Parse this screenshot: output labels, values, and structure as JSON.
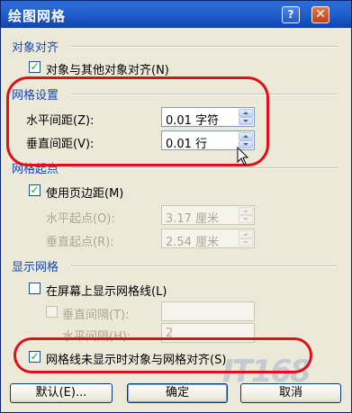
{
  "window": {
    "title": "绘图网格",
    "help_glyph": "?",
    "close_glyph": "✕"
  },
  "snap": {
    "header": "对象对齐",
    "snap_to_objects": {
      "label": "对象与其他对象对齐(N)",
      "checked": true
    }
  },
  "grid_settings": {
    "header": "网格设置",
    "horizontal_spacing": {
      "label": "水平间距(Z):",
      "value": "0.01 字符"
    },
    "vertical_spacing": {
      "label": "垂直间距(V):",
      "value": "0.01 行"
    }
  },
  "grid_origin": {
    "header": "网格起点",
    "use_margins": {
      "label": "使用页边距(M)",
      "checked": true
    },
    "horizontal_origin": {
      "label": "水平起点(O):",
      "value": "3.17 厘米"
    },
    "vertical_origin": {
      "label": "垂直起点(R):",
      "value": "2.54 厘米"
    }
  },
  "display_grid": {
    "header": "显示网格",
    "show_gridlines": {
      "label": "在屏幕上显示网格线(L)",
      "checked": false
    },
    "vertical_every": {
      "label": "垂直间隔(T):",
      "value": ""
    },
    "horizontal_every": {
      "label": "水平间隔(H):",
      "value": "2"
    },
    "snap_when_hidden": {
      "label": "网格线未显示时对象与网格对齐(S)",
      "checked": true
    }
  },
  "buttons": {
    "default": "默认(E)...",
    "ok": "确定",
    "cancel": "取消"
  },
  "watermark": "IT168",
  "colors": {
    "title_bar": "#0d45b3",
    "section_header": "#1747b0",
    "annotation_ring": "#e0101a"
  }
}
